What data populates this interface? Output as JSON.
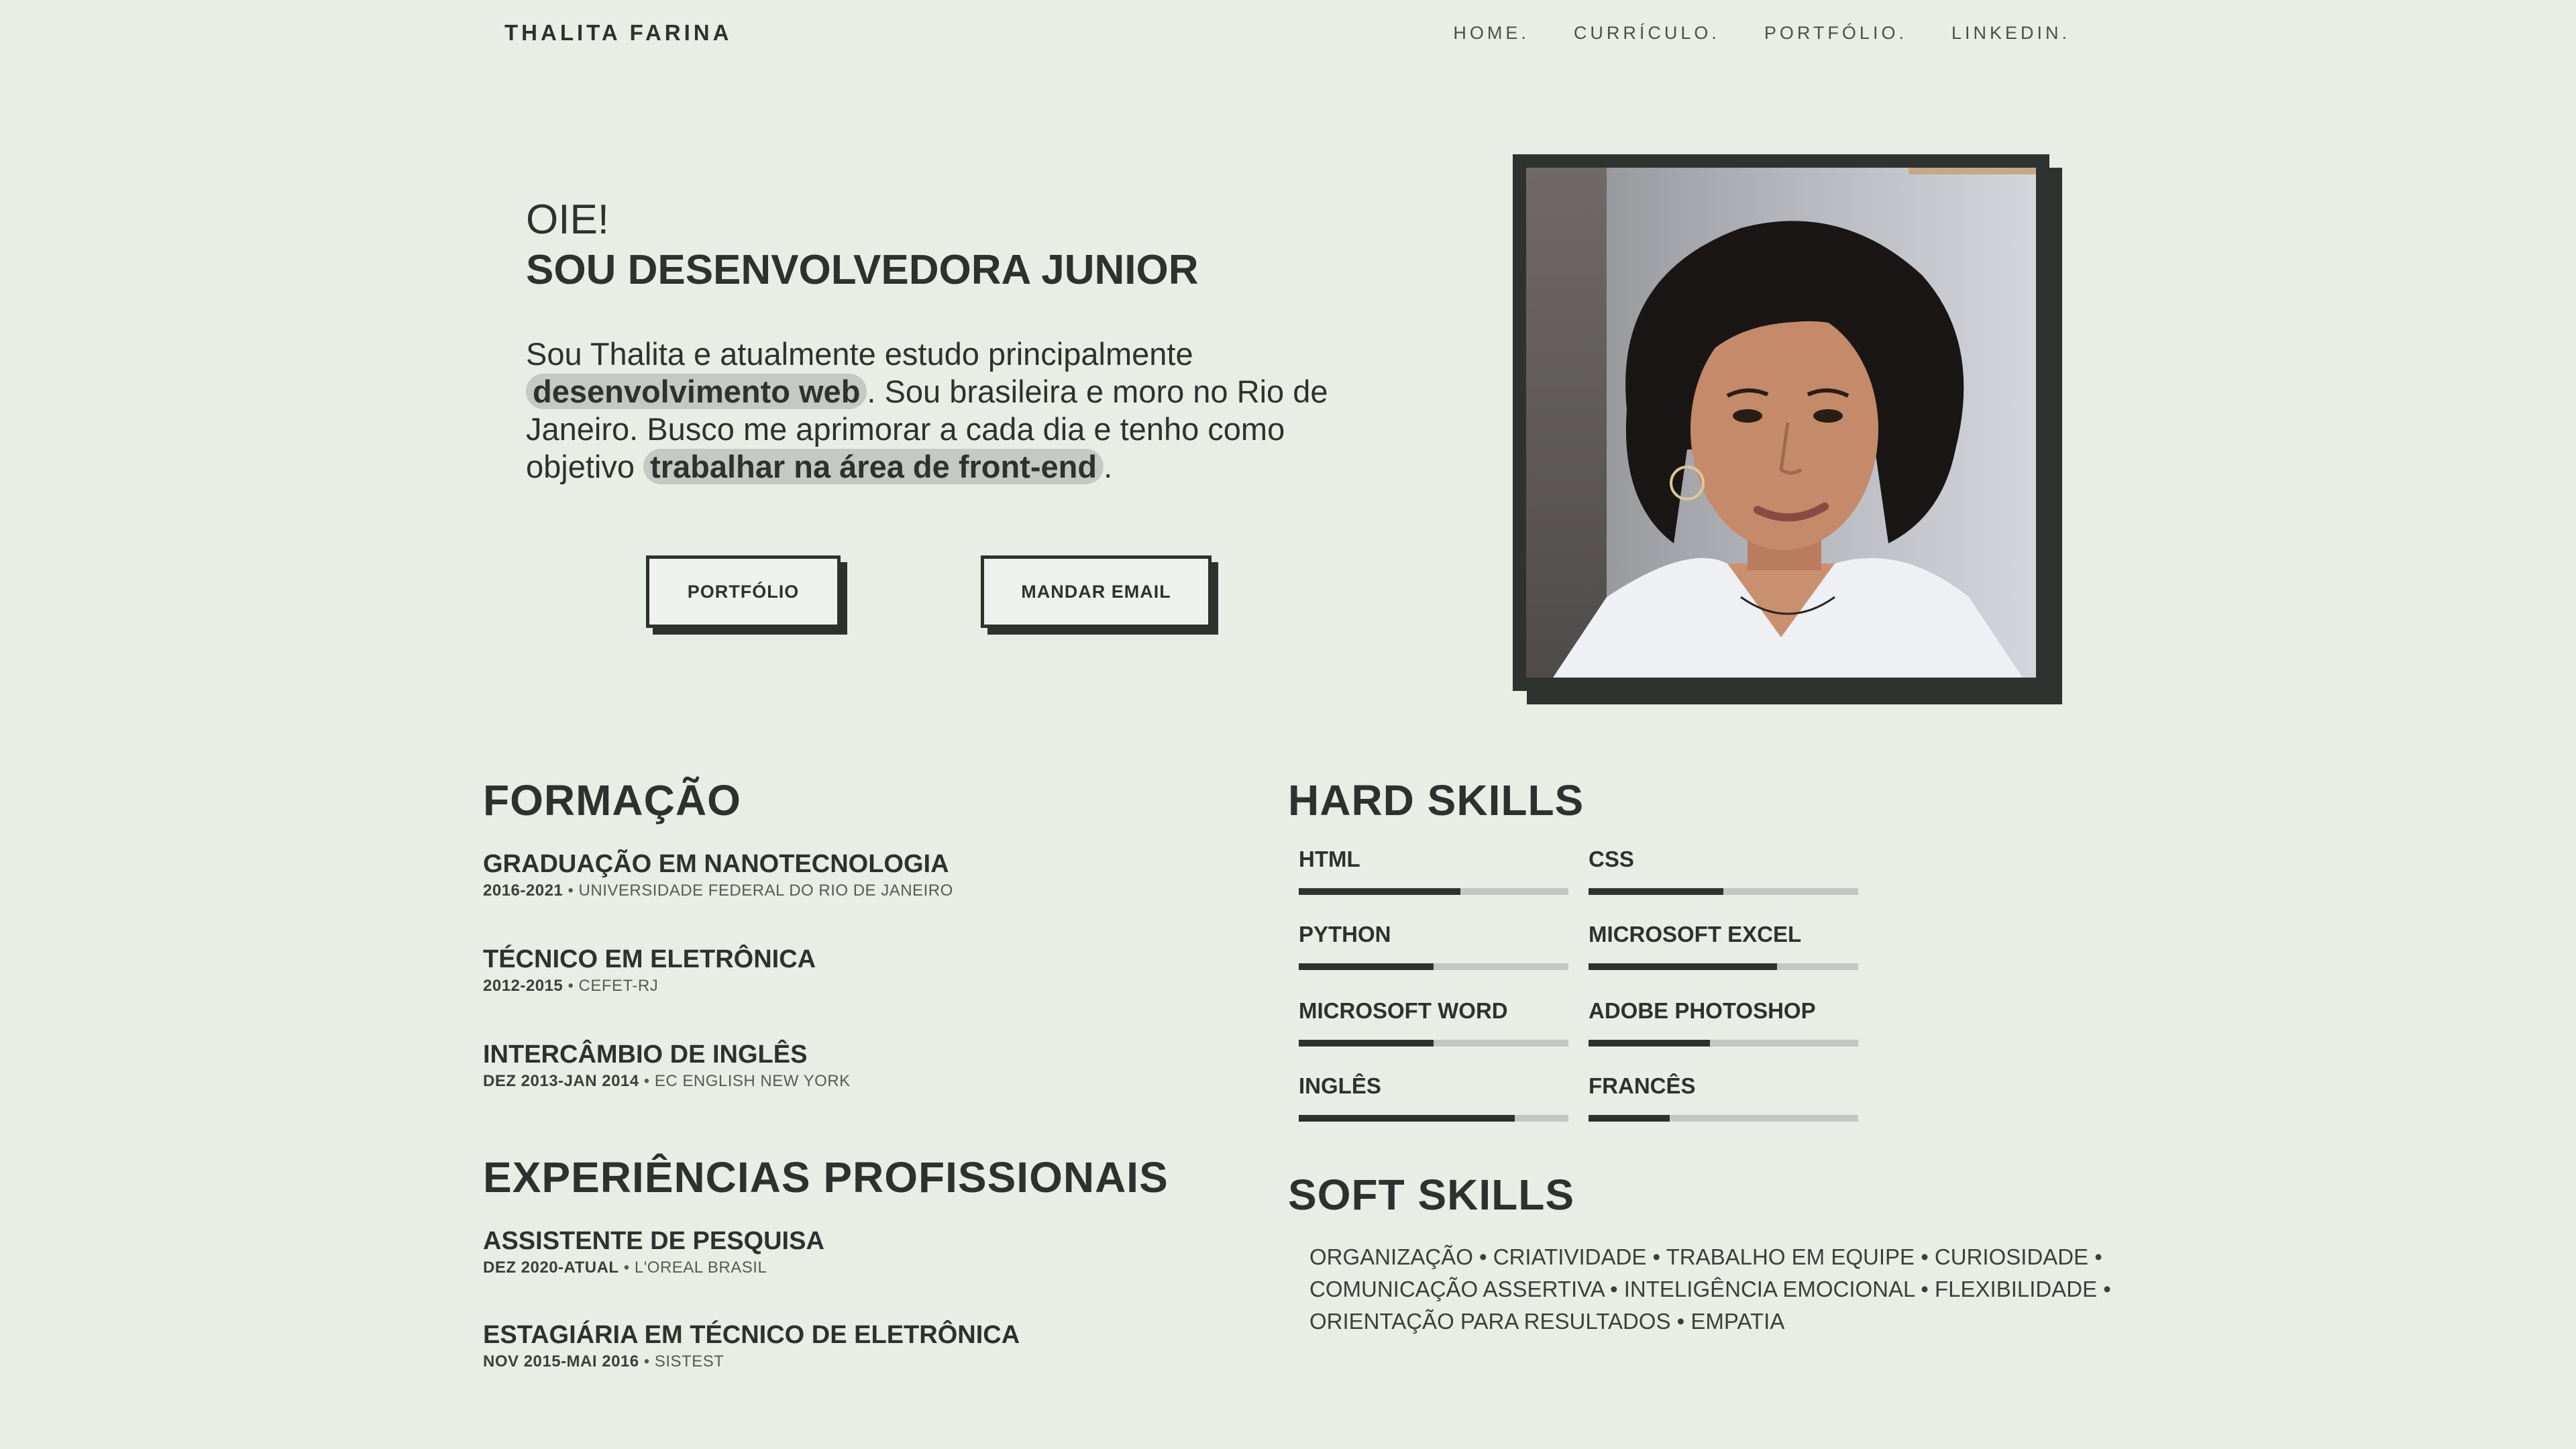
{
  "brand": "THALITA FARINA",
  "nav": [
    "HOME.",
    "CURRÍCULO.",
    "PORTFÓLIO.",
    "LINKEDIN."
  ],
  "hero": {
    "greeting": "OIE!",
    "headline": "SOU DESENVOLVEDORA JUNIOR",
    "intro_1": "Sou Thalita e atualmente estudo principalmente ",
    "intro_hl_1": "desenvolvimento web",
    "intro_2": ". Sou brasileira e moro no Rio de Janeiro. Busco me aprimorar a cada dia e tenho como objetivo ",
    "intro_hl_2": "trabalhar na área de front-end",
    "intro_3": ".",
    "btn_portfolio": "PORTFÓLIO",
    "btn_email": "MANDAR EMAIL"
  },
  "formacao": {
    "title": "FORMAÇÃO",
    "items": [
      {
        "title": "GRADUAÇÃO EM NANOTECNOLOGIA",
        "dates": "2016-2021",
        "place": "UNIVERSIDADE FEDERAL DO RIO DE JANEIRO"
      },
      {
        "title": "TÉCNICO EM ELETRÔNICA",
        "dates": "2012-2015",
        "place": "CEFET-RJ"
      },
      {
        "title": "INTERCÂMBIO DE INGLÊS",
        "dates": "DEZ 2013-JAN 2014",
        "place": "EC ENGLISH NEW YORK"
      }
    ]
  },
  "experiencias": {
    "title": "EXPERIÊNCIAS PROFISSIONAIS",
    "items": [
      {
        "title": "ASSISTENTE DE PESQUISA",
        "dates": "DEZ 2020-ATUAL",
        "place": "L'OREAL BRASIL"
      },
      {
        "title": "ESTAGIÁRIA EM TÉCNICO DE ELETRÔNICA",
        "dates": "NOV 2015-MAI 2016",
        "place": "SISTEST"
      }
    ]
  },
  "hard_skills": {
    "title": "HARD SKILLS",
    "items": [
      {
        "label": "HTML",
        "level": 0.6
      },
      {
        "label": "CSS",
        "level": 0.5
      },
      {
        "label": "PYTHON",
        "level": 0.5
      },
      {
        "label": "MICROSOFT EXCEL",
        "level": 0.7
      },
      {
        "label": "MICROSOFT WORD",
        "level": 0.5
      },
      {
        "label": "ADOBE PHOTOSHOP",
        "level": 0.45
      },
      {
        "label": "INGLÊS",
        "level": 0.8
      },
      {
        "label": "FRANCÊS",
        "level": 0.3
      }
    ]
  },
  "soft_skills": {
    "title": "SOFT SKILLS",
    "text": "ORGANIZAÇÃO • CRIATIVIDADE • TRABALHO EM EQUIPE • CURIOSIDADE • COMUNICAÇÃO ASSERTIVA • INTELIGÊNCIA EMOCIONAL • FLEXIBILIDADE • ORIENTAÇÃO PARA RESULTADOS • EMPATIA"
  },
  "colors": {
    "background": "#e8ede6",
    "text": "#2e322f",
    "highlight": "#c6c8c3",
    "track": "#c4c6c3"
  }
}
